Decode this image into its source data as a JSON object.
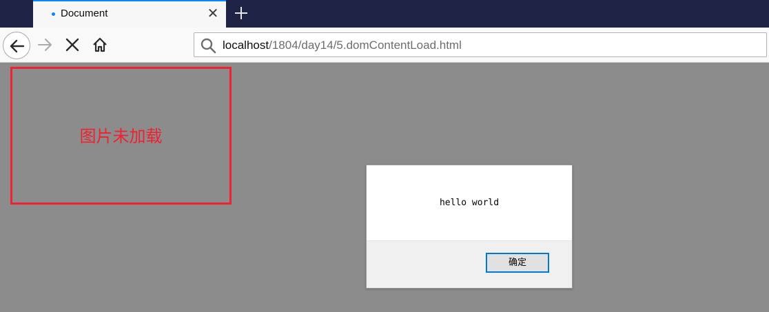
{
  "browser": {
    "tab": {
      "title": "Document",
      "close_glyph": "✕"
    },
    "url": {
      "host": "localhost",
      "path": "/1804/day14/5.domContentLoad.html"
    },
    "icons": {
      "back": "back-arrow-icon",
      "forward": "forward-arrow-icon",
      "stop": "stop-icon",
      "home": "home-icon",
      "search": "search-icon",
      "new_tab": "plus-icon"
    }
  },
  "page": {
    "image_placeholder_text": "图片未加载"
  },
  "dialog": {
    "message": "hello world",
    "ok_label": "确定"
  },
  "colors": {
    "tabstrip": "#1f2346",
    "accent": "#0a84ff",
    "overlay": "#8c8c8c",
    "image_border": "#ee2230"
  }
}
